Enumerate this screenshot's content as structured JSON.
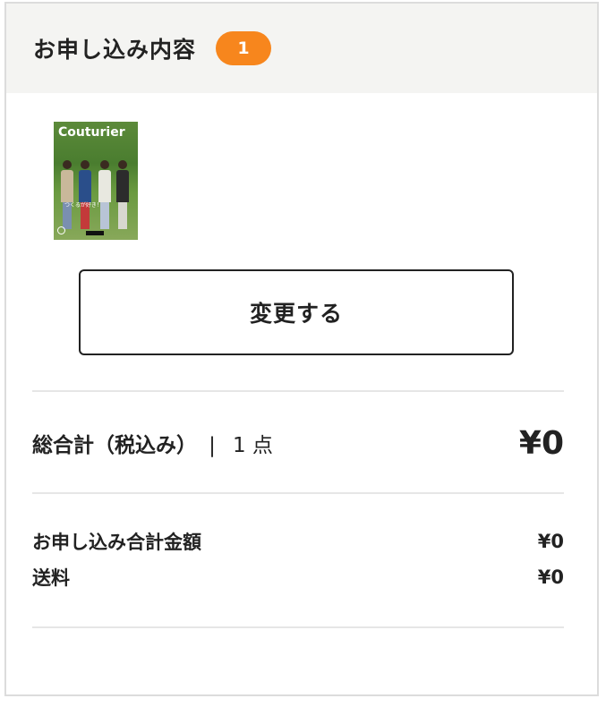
{
  "header": {
    "title": "お申し込み内容",
    "badge": "1"
  },
  "item": {
    "thumbnail_icon": "magazine-cover",
    "cover_title": "Couturier",
    "cover_caption": "つくるが好き！"
  },
  "change_button": {
    "label": "変更する"
  },
  "total": {
    "label": "総合計（税込み）",
    "separator": "|",
    "count": "1 点",
    "value": "¥0"
  },
  "breakdown": [
    {
      "label": "お申し込み合計金額",
      "value": "¥0"
    },
    {
      "label": "送料",
      "value": "¥0"
    }
  ],
  "colors": {
    "accent": "#f7861d",
    "header_bg": "#f4f4f2",
    "border": "#dcdcdc"
  }
}
